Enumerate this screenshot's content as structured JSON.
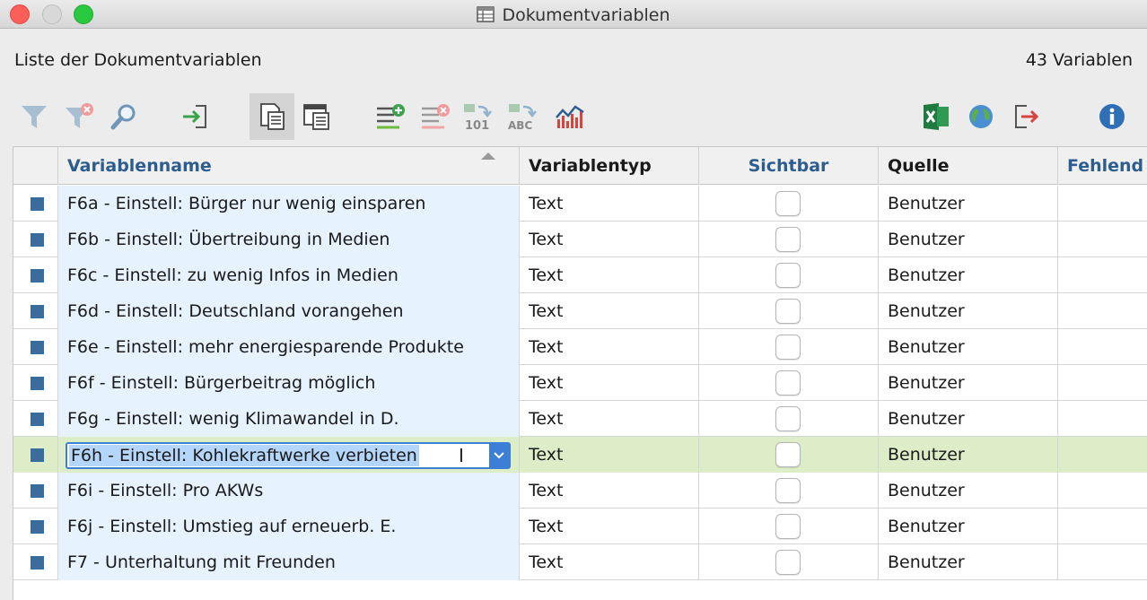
{
  "window": {
    "title": "Dokumentvariablen"
  },
  "header": {
    "list_label": "Liste der Dokumentvariablen",
    "count": "43 Variablen"
  },
  "toolbar": {
    "icons": [
      "filter-icon",
      "filter-clear-icon",
      "search-icon",
      "import-icon",
      "list-view-icon",
      "detail-view-icon",
      "add-variable-icon",
      "delete-variable-icon",
      "convert-number-icon",
      "convert-text-icon",
      "statistics-icon",
      "excel-export-icon",
      "web-export-icon",
      "export-icon",
      "info-icon"
    ]
  },
  "table": {
    "columns": [
      "Variablenname",
      "Variablentyp",
      "Sichtbar",
      "Quelle",
      "Fehlend"
    ],
    "rows": [
      {
        "name": "F6a - Einstell: Bürger nur wenig einsparen",
        "type": "Text",
        "visible": false,
        "source": "Benutzer"
      },
      {
        "name": "F6b - Einstell: Übertreibung in Medien",
        "type": "Text",
        "visible": false,
        "source": "Benutzer"
      },
      {
        "name": "F6c - Einstell: zu wenig Infos in Medien",
        "type": "Text",
        "visible": false,
        "source": "Benutzer"
      },
      {
        "name": "F6d - Einstell: Deutschland vorangehen",
        "type": "Text",
        "visible": false,
        "source": "Benutzer"
      },
      {
        "name": "F6e - Einstell: mehr energiesparende Produkte",
        "type": "Text",
        "visible": false,
        "source": "Benutzer"
      },
      {
        "name": "F6f - Einstell: Bürgerbeitrag möglich",
        "type": "Text",
        "visible": false,
        "source": "Benutzer"
      },
      {
        "name": "F6g - Einstell: wenig Klimawandel in D.",
        "type": "Text",
        "visible": false,
        "source": "Benutzer"
      },
      {
        "name": "F6h - Einstell: Kohlekraftwerke verbieten",
        "type": "Text",
        "visible": false,
        "source": "Benutzer",
        "selected": true,
        "editing": true
      },
      {
        "name": "F6i - Einstell: Pro AKWs",
        "type": "Text",
        "visible": false,
        "source": "Benutzer"
      },
      {
        "name": "F6j - Einstell: Umstieg auf erneuerb. E.",
        "type": "Text",
        "visible": false,
        "source": "Benutzer"
      },
      {
        "name": "F7 - Unterhaltung mit Freunden",
        "type": "Text",
        "visible": false,
        "source": "Benutzer"
      }
    ]
  },
  "colors": {
    "link": "#2d5d8e",
    "name_column_bg": "#e6f2fd",
    "selected_row_bg": "#dcedc8",
    "marker": "#3a6d9c",
    "focus": "#3b7fd6"
  }
}
